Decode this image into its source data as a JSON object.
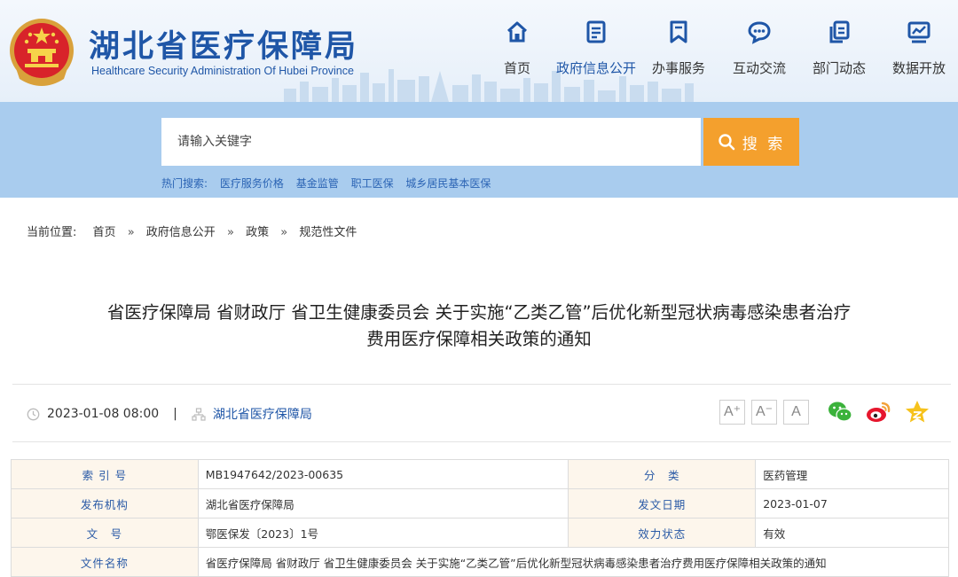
{
  "header": {
    "title": "湖北省医疗保障局",
    "subtitle": "Healthcare Security Administration Of Hubei Province",
    "nav": [
      {
        "label": "首页",
        "icon": "home-icon"
      },
      {
        "label": "政府信息公开",
        "icon": "document-list-icon",
        "active": true
      },
      {
        "label": "办事服务",
        "icon": "bookmark-icon"
      },
      {
        "label": "互动交流",
        "icon": "chat-bubble-icon"
      },
      {
        "label": "部门动态",
        "icon": "copy-pages-icon"
      },
      {
        "label": "数据开放",
        "icon": "chart-board-icon"
      }
    ]
  },
  "search": {
    "placeholder": "请输入关键字",
    "button_label": "搜 索",
    "hot_label": "热门搜索:",
    "hot_terms": [
      "医疗服务价格",
      "基金监管",
      "职工医保",
      "城乡居民基本医保"
    ]
  },
  "breadcrumb": {
    "label": "当前位置:",
    "items": [
      "首页",
      "政府信息公开",
      "政策",
      "规范性文件"
    ],
    "separator": "»"
  },
  "document": {
    "title_line1": "省医疗保障局 省财政厅 省卫生健康委员会 关于实施“乙类乙管”后优化新型冠状病毒感染患者治疗",
    "title_line2": "费用医疗保障相关政策的通知",
    "date": "2023-01-08 08:00",
    "divider": "|",
    "publisher": "湖北省医疗保障局",
    "font_buttons": [
      "A⁺",
      "A⁻",
      "A"
    ]
  },
  "info_table": {
    "rows": [
      {
        "k1": "索 引 号",
        "v1": "MB1947642/2023-00635",
        "k2": "分　类",
        "v2": "医药管理"
      },
      {
        "k1": "发布机构",
        "v1": "湖北省医疗保障局",
        "k2": "发文日期",
        "v2": "2023-01-07"
      },
      {
        "k1": "文　号",
        "v1": "鄂医保发〔2023〕1号",
        "k2": "效力状态",
        "v2": "有效"
      }
    ],
    "name_key": "文件名称",
    "name_value": "省医疗保障局 省财政厅 省卫生健康委员会 关于实施“乙类乙管”后优化新型冠状病毒感染患者治疗费用医疗保障相关政策的通知"
  },
  "colors": {
    "brand_blue": "#1f56a7",
    "search_band": "#a9ccee",
    "search_button": "#f4a02d",
    "table_key_bg": "#fdf6ec"
  }
}
